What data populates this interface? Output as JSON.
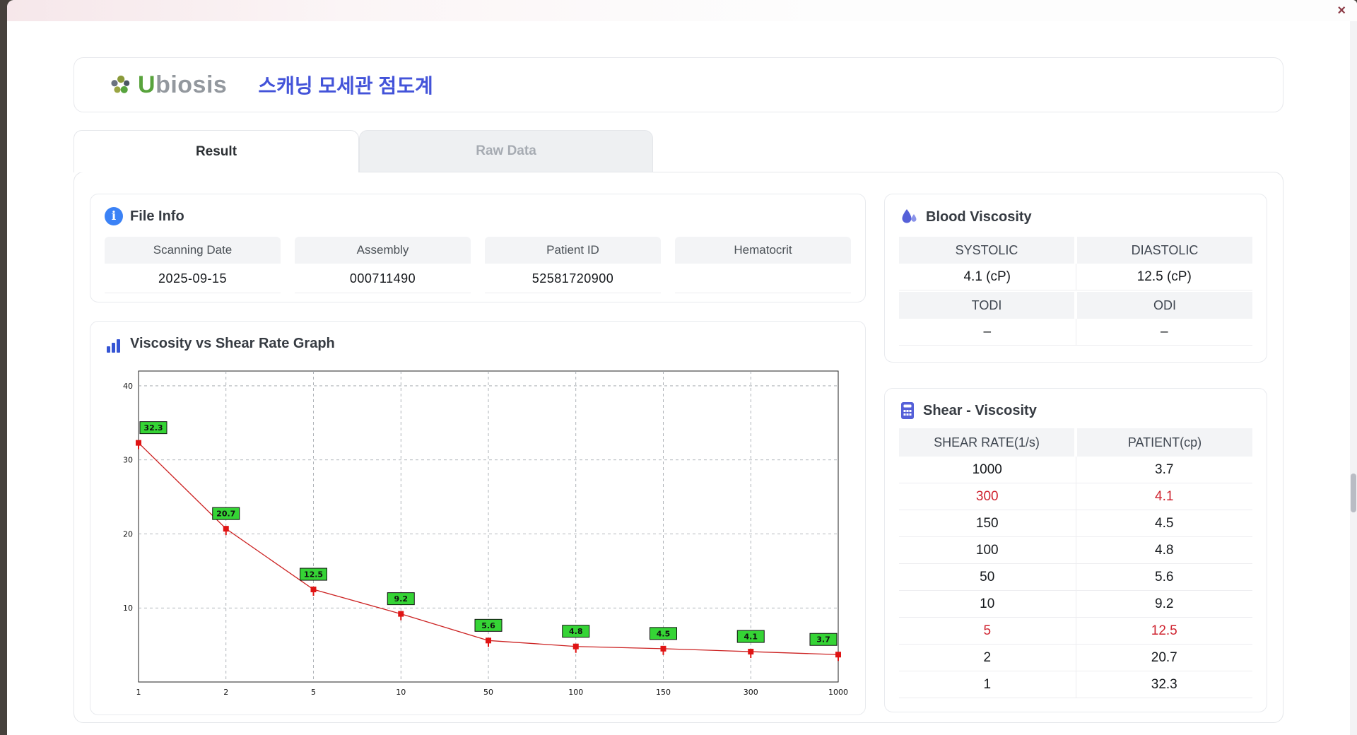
{
  "window": {
    "close_label": "×"
  },
  "header": {
    "brand_first": "U",
    "brand_rest": "biosis",
    "app_title": "스캐닝 모세관 점도계"
  },
  "tabs": [
    {
      "label": "Result",
      "active": true
    },
    {
      "label": "Raw Data",
      "active": false
    }
  ],
  "file_info": {
    "title": "File Info",
    "fields": [
      {
        "label": "Scanning Date",
        "value": "2025-09-15"
      },
      {
        "label": "Assembly",
        "value": "000711490"
      },
      {
        "label": "Patient ID",
        "value": "52581720900"
      },
      {
        "label": "Hematocrit",
        "value": ""
      }
    ]
  },
  "blood_viscosity": {
    "title": "Blood Viscosity",
    "cells": [
      {
        "label": "SYSTOLIC",
        "value": "4.1 (cP)"
      },
      {
        "label": "DIASTOLIC",
        "value": "12.5 (cP)"
      },
      {
        "label": "TODI",
        "value": "–"
      },
      {
        "label": "ODI",
        "value": "–"
      }
    ]
  },
  "shear_viscosity": {
    "title": "Shear - Viscosity",
    "columns": [
      "SHEAR RATE(1/s)",
      "PATIENT(cp)"
    ],
    "rows": [
      {
        "shear": "1000",
        "patient": "3.7",
        "highlight": false
      },
      {
        "shear": "300",
        "patient": "4.1",
        "highlight": true
      },
      {
        "shear": "150",
        "patient": "4.5",
        "highlight": false
      },
      {
        "shear": "100",
        "patient": "4.8",
        "highlight": false
      },
      {
        "shear": "50",
        "patient": "5.6",
        "highlight": false
      },
      {
        "shear": "10",
        "patient": "9.2",
        "highlight": false
      },
      {
        "shear": "5",
        "patient": "12.5",
        "highlight": true
      },
      {
        "shear": "2",
        "patient": "20.7",
        "highlight": false
      },
      {
        "shear": "1",
        "patient": "32.3",
        "highlight": false
      }
    ]
  },
  "chart_data": {
    "type": "line",
    "title": "Viscosity vs Shear Rate Graph",
    "categories": [
      "1",
      "2",
      "5",
      "10",
      "50",
      "100",
      "150",
      "300",
      "1000"
    ],
    "values": [
      32.3,
      20.7,
      12.5,
      9.2,
      5.6,
      4.8,
      4.5,
      4.1,
      3.7
    ],
    "xlabel": "",
    "ylabel": "",
    "ylim": [
      0,
      42
    ],
    "yticks": [
      10,
      20,
      30,
      40
    ],
    "grid": "dashed",
    "legend": "none",
    "line_color": "#cc2222",
    "marker_color": "#e01414",
    "label_bg": "#35d435"
  }
}
